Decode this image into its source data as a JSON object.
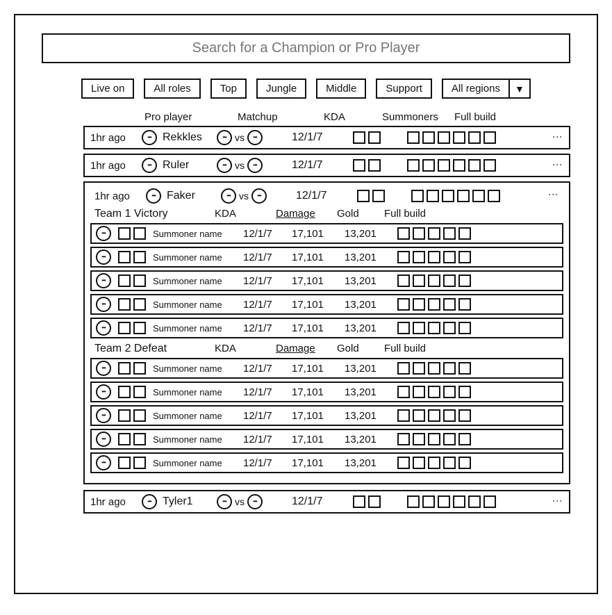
{
  "search": {
    "placeholder": "Search for a Champion or Pro Player"
  },
  "filters": {
    "live": "Live on",
    "roles": [
      "All roles",
      "Top",
      "Jungle",
      "Middle",
      "Support"
    ],
    "region": "All regions"
  },
  "headers": {
    "pro_player": "Pro player",
    "matchup": "Matchup",
    "kda": "KDA",
    "summoners": "Summoners",
    "full_build": "Full build"
  },
  "team_headers": {
    "kda": "KDA",
    "damage": "Damage",
    "gold": "Gold",
    "full_build": "Full build"
  },
  "matches": [
    {
      "time": "1hr ago",
      "player": "Rekkles",
      "vs": "vs",
      "kda": "12/1/7"
    },
    {
      "time": "1hr ago",
      "player": "Ruler",
      "vs": "vs",
      "kda": "12/1/7"
    },
    {
      "time": "1hr ago",
      "player": "Faker",
      "vs": "vs",
      "kda": "12/1/7",
      "expanded": true,
      "teams": [
        {
          "title": "Team 1 Victory",
          "players": [
            {
              "name": "Summoner name",
              "kda": "12/1/7",
              "damage": "17,101",
              "gold": "13,201"
            },
            {
              "name": "Summoner name",
              "kda": "12/1/7",
              "damage": "17,101",
              "gold": "13,201"
            },
            {
              "name": "Summoner name",
              "kda": "12/1/7",
              "damage": "17,101",
              "gold": "13,201"
            },
            {
              "name": "Summoner name",
              "kda": "12/1/7",
              "damage": "17,101",
              "gold": "13,201"
            },
            {
              "name": "Summoner name",
              "kda": "12/1/7",
              "damage": "17,101",
              "gold": "13,201"
            }
          ]
        },
        {
          "title": "Team 2 Defeat",
          "players": [
            {
              "name": "Summoner name",
              "kda": "12/1/7",
              "damage": "17,101",
              "gold": "13,201"
            },
            {
              "name": "Summoner name",
              "kda": "12/1/7",
              "damage": "17,101",
              "gold": "13,201"
            },
            {
              "name": "Summoner name",
              "kda": "12/1/7",
              "damage": "17,101",
              "gold": "13,201"
            },
            {
              "name": "Summoner name",
              "kda": "12/1/7",
              "damage": "17,101",
              "gold": "13,201"
            },
            {
              "name": "Summoner name",
              "kda": "12/1/7",
              "damage": "17,101",
              "gold": "13,201"
            }
          ]
        }
      ]
    },
    {
      "time": "1hr ago",
      "player": "Tyler1",
      "vs": "vs",
      "kda": "12/1/7"
    }
  ]
}
